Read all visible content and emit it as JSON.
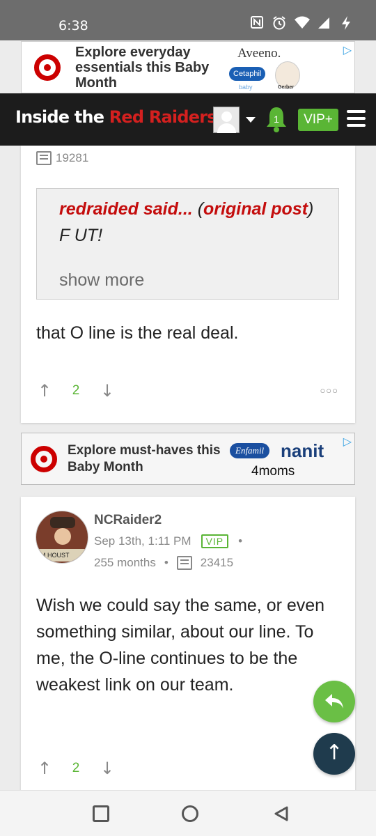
{
  "status_bar": {
    "time": "6:38",
    "icons": [
      "nfc-icon",
      "alarm-icon",
      "wifi-icon",
      "signal-icon",
      "battery-charging-icon"
    ]
  },
  "ad_top": {
    "text": "Explore everyday essentials this Baby Month",
    "brands": [
      "Aveeno.",
      "Cetaphil",
      "baby",
      "Gerber"
    ]
  },
  "header": {
    "logo_part1": "Inside the",
    "logo_part2": "Red Raiders",
    "notification_count": "1",
    "vip_label": "VIP+"
  },
  "post1": {
    "comment_count": "19281",
    "quote": {
      "author": "redraided said...",
      "open_paren": " (",
      "link": "original post",
      "close_text": ") F UT!",
      "show_more": "show more"
    },
    "body": "that O line is the real deal.",
    "votes": "2"
  },
  "ad_middle": {
    "text": "Explore must-haves this Baby Month",
    "brands": [
      "Enfamil",
      "nanit",
      "4moms"
    ]
  },
  "post2": {
    "username": "NCRaider2",
    "date": "Sep 13th, 1:11 PM",
    "badge": "VIP",
    "tenure": "255 months",
    "comment_count": "23415",
    "avatar_sign": "M HOUST",
    "body": "Wish we could say the same, or even something similar, about our line. To me, the O-line continues to be the weakest link on our team.",
    "votes": "2"
  },
  "colors": {
    "brand_red": "#c40d0d",
    "accent_green": "#5ab535",
    "header_bg": "#1c1c1c",
    "scroll_top_bg": "#1f3b4d"
  }
}
